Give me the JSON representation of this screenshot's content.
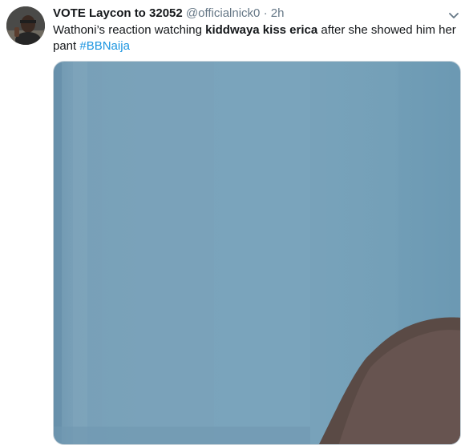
{
  "tweet": {
    "display_name": "VOTE Laycon to 32052",
    "handle": "@officialnick0",
    "separator": "·",
    "timestamp": "2h",
    "text": {
      "part1": "Wathoni’s reaction watching ",
      "bold": "kiddwaya kiss erica",
      "part2": " after she showed him her pant ",
      "hashtag": "#BBNaija"
    }
  },
  "icons": {
    "avatar": "user-avatar",
    "caret": "chevron-down-icon"
  },
  "colors": {
    "link": "#1b95e0",
    "secondary_text": "#657786",
    "media_background": "#79a3bb"
  }
}
